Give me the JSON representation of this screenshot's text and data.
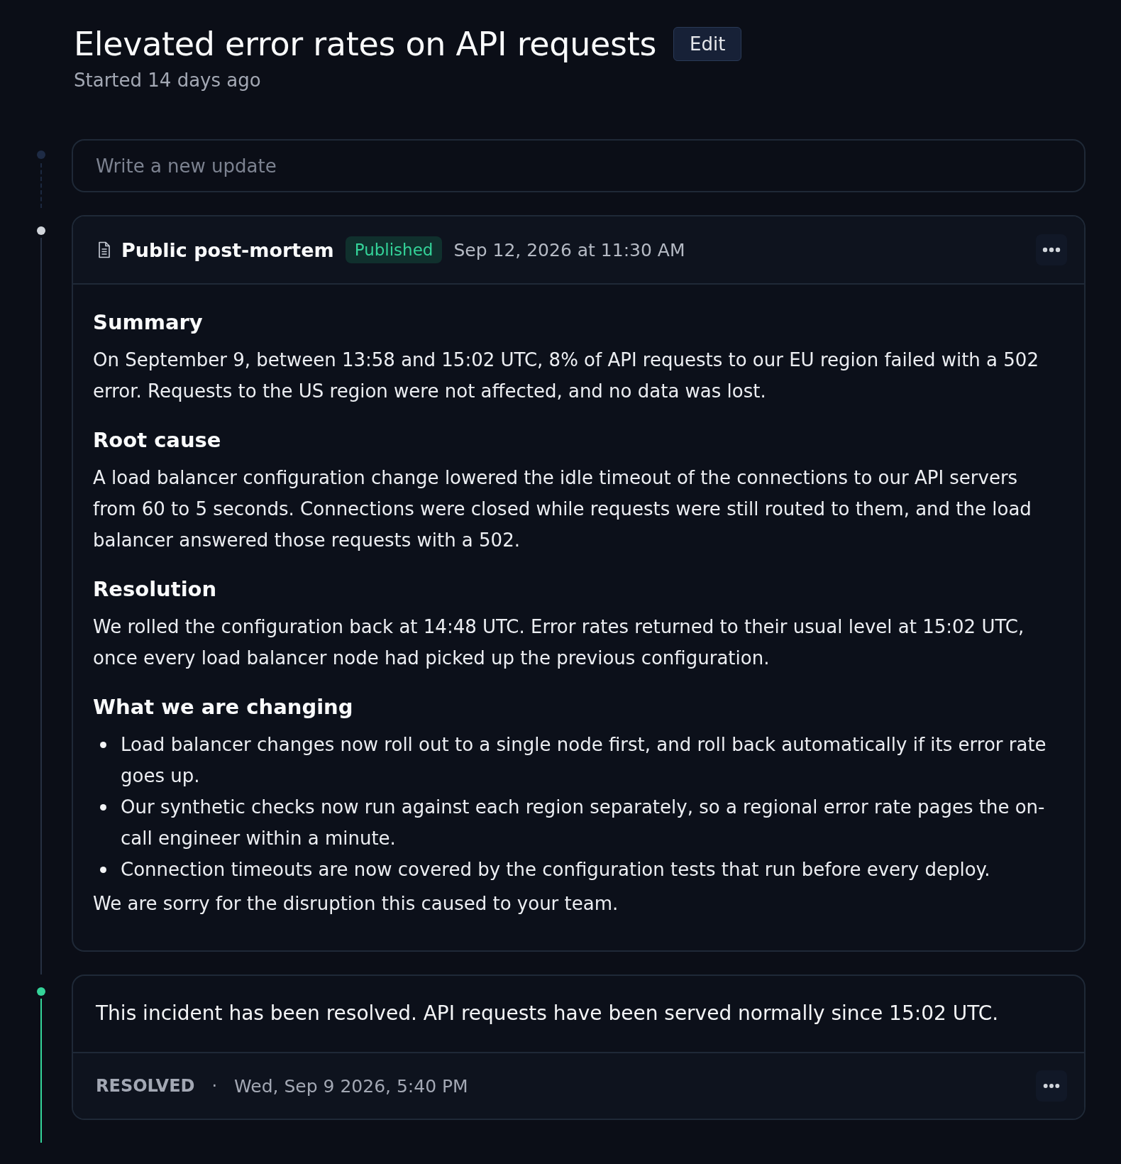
{
  "incident": {
    "title": "Elevated error rates on API requests",
    "edit_button": "Edit",
    "started": "Started 14 days ago"
  },
  "composer": {
    "placeholder": "Write a new update",
    "color": "#1e2b45"
  },
  "timeline": [
    {
      "kind": "post_mortem",
      "color": "#d1d5db",
      "title": "Public post-mortem",
      "status": "Published",
      "date": "Sep 12, 2026 at 11:30 AM",
      "sections": [
        {
          "heading": "Summary",
          "body": [
            {
              "kind": "paragraph",
              "text": "On September 9, between 13:58 and 15:02 UTC, 8% of API requests to our EU region failed with a 502 error. Requests to the US region were not affected, and no data was lost."
            }
          ]
        },
        {
          "heading": "Root cause",
          "body": [
            {
              "kind": "paragraph",
              "text": "A load balancer configuration change lowered the idle timeout of the connections to our API servers from 60 to 5 seconds. Connections were closed while requests were still routed to them, and the load balancer answered those requests with a 502."
            }
          ]
        },
        {
          "heading": "Resolution",
          "body": [
            {
              "kind": "paragraph",
              "text": "We rolled the configuration back at 14:48 UTC. Error rates returned to their usual level at 15:02 UTC, once every load balancer node had picked up the previous configuration."
            }
          ]
        },
        {
          "heading": "What we are changing",
          "body": [
            {
              "kind": "bullets",
              "items": [
                "Load balancer changes now roll out to a single node first, and roll back automatically if its error rate goes up.",
                "Our synthetic checks now run against each region separately, so a regional error rate pages the on-call engineer within a minute.",
                "Connection timeouts are now covered by the configuration tests that run before every deploy."
              ]
            },
            {
              "kind": "paragraph",
              "text": "We are sorry for the disruption this caused to your team."
            }
          ]
        }
      ]
    },
    {
      "kind": "update",
      "color": "#34d399",
      "message": "This incident has been resolved. API requests have been served normally since 15:02 UTC.",
      "status": "RESOLVED",
      "separator": "·",
      "date": "Wed, Sep 9 2026, 5:40 PM"
    }
  ]
}
